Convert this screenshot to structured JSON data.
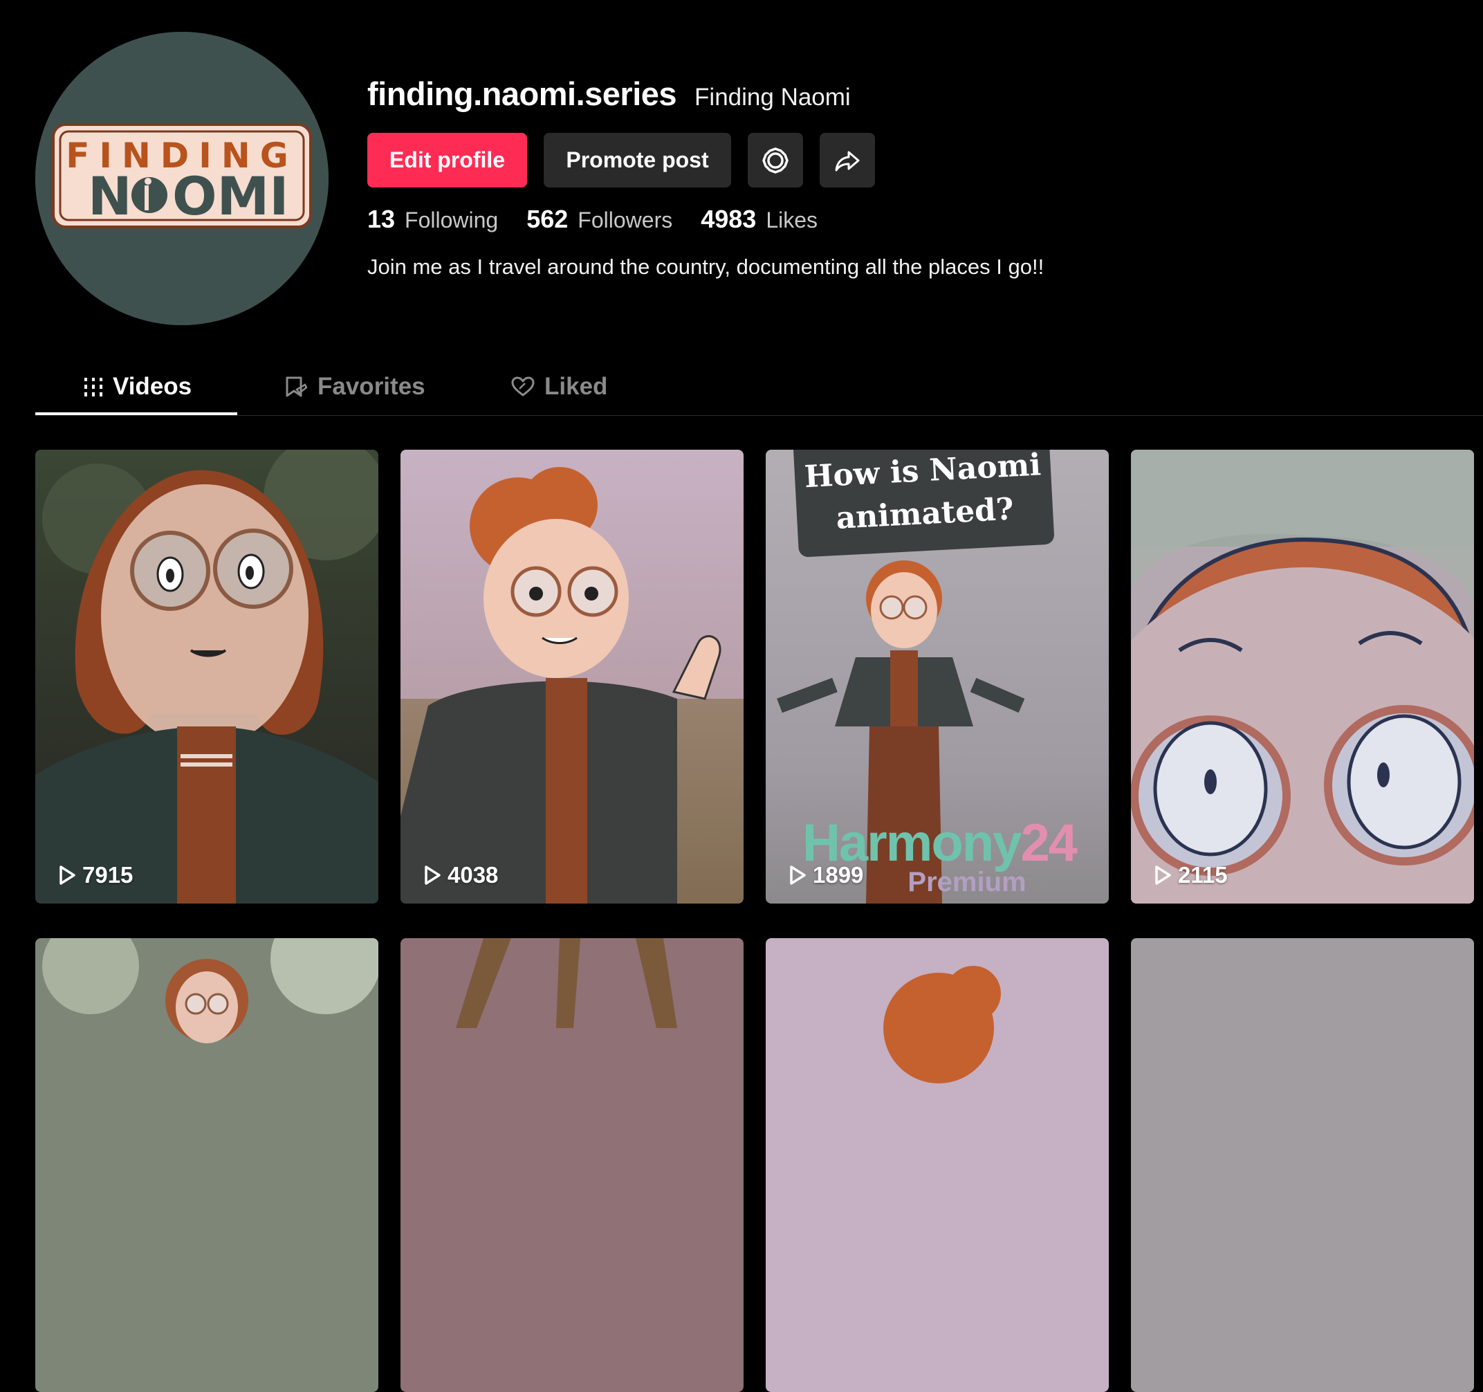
{
  "profile": {
    "username": "finding.naomi.series",
    "nickname": "Finding Naomi",
    "bio": "Join me as I travel around the country, documenting all the places I go!!",
    "avatar_logo": {
      "line1": "FINDING",
      "line2a": "N",
      "line2b": "OMI"
    }
  },
  "buttons": {
    "edit_profile": "Edit profile",
    "promote_post": "Promote post",
    "settings_icon": "gear-icon",
    "share_icon": "share-arrow-icon"
  },
  "stats": [
    {
      "value": "13",
      "label": "Following"
    },
    {
      "value": "562",
      "label": "Followers"
    },
    {
      "value": "4983",
      "label": "Likes"
    }
  ],
  "tabs": [
    {
      "label": "Videos",
      "icon": "grid-bars-icon",
      "active": true
    },
    {
      "label": "Favorites",
      "icon": "bookmark-icon",
      "active": false
    },
    {
      "label": "Liked",
      "icon": "heart-icon",
      "active": false
    }
  ],
  "videos": [
    {
      "views": "7915"
    },
    {
      "views": "4038"
    },
    {
      "views": "1899",
      "overlay_title_line1": "How is Naomi",
      "overlay_title_line2": "animated?",
      "watermark_a": "Harmony",
      "watermark_b": "24",
      "watermark_sub": "Premium"
    },
    {
      "views": "2115"
    }
  ],
  "colors": {
    "accent": "#fe2c55",
    "button_secondary": "#2a2a2a",
    "background": "#000000",
    "avatar_bg": "#3f514f"
  }
}
